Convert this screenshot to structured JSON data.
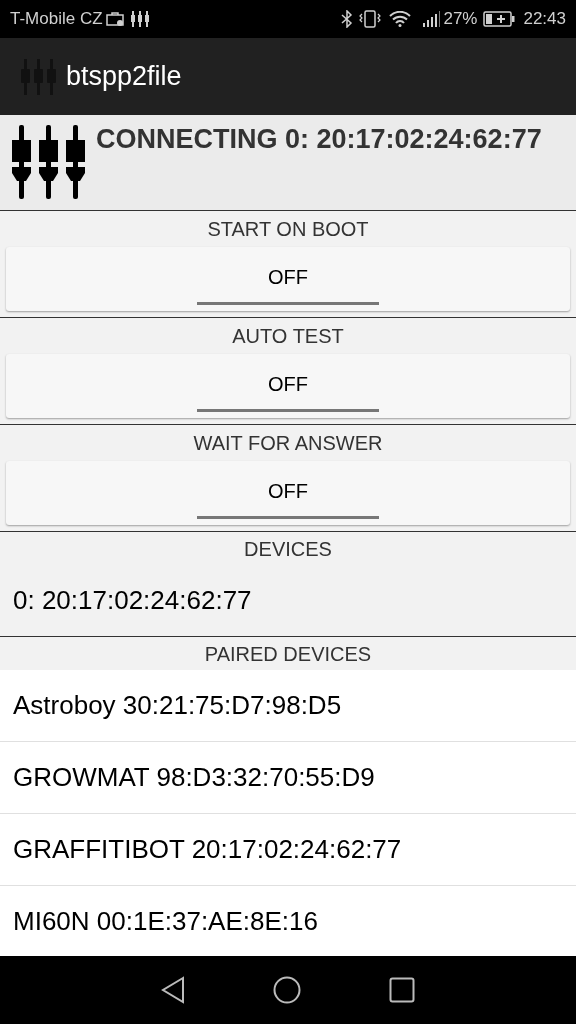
{
  "status_bar": {
    "carrier": "T-Mobile CZ",
    "battery": "27%",
    "time": "22:43"
  },
  "app_bar": {
    "title": "btspp2file"
  },
  "header": {
    "text": "CONNECTING 0: 20:17:02:24:62:77"
  },
  "toggles": [
    {
      "label": "START ON BOOT",
      "value": "OFF",
      "on": false
    },
    {
      "label": "AUTO TEST",
      "value": "OFF",
      "on": false
    },
    {
      "label": "WAIT FOR ANSWER",
      "value": "OFF",
      "on": false
    }
  ],
  "devices": {
    "title": "DEVICES",
    "items": [
      "0: 20:17:02:24:62:77"
    ]
  },
  "paired_devices": {
    "title": "PAIRED DEVICES",
    "items": [
      "Astroboy 30:21:75:D7:98:D5",
      "GROWMAT 98:D3:32:70:55:D9",
      "GRAFFITIBOT 20:17:02:24:62:77",
      "MI60N 00:1E:37:AE:8E:16"
    ]
  }
}
